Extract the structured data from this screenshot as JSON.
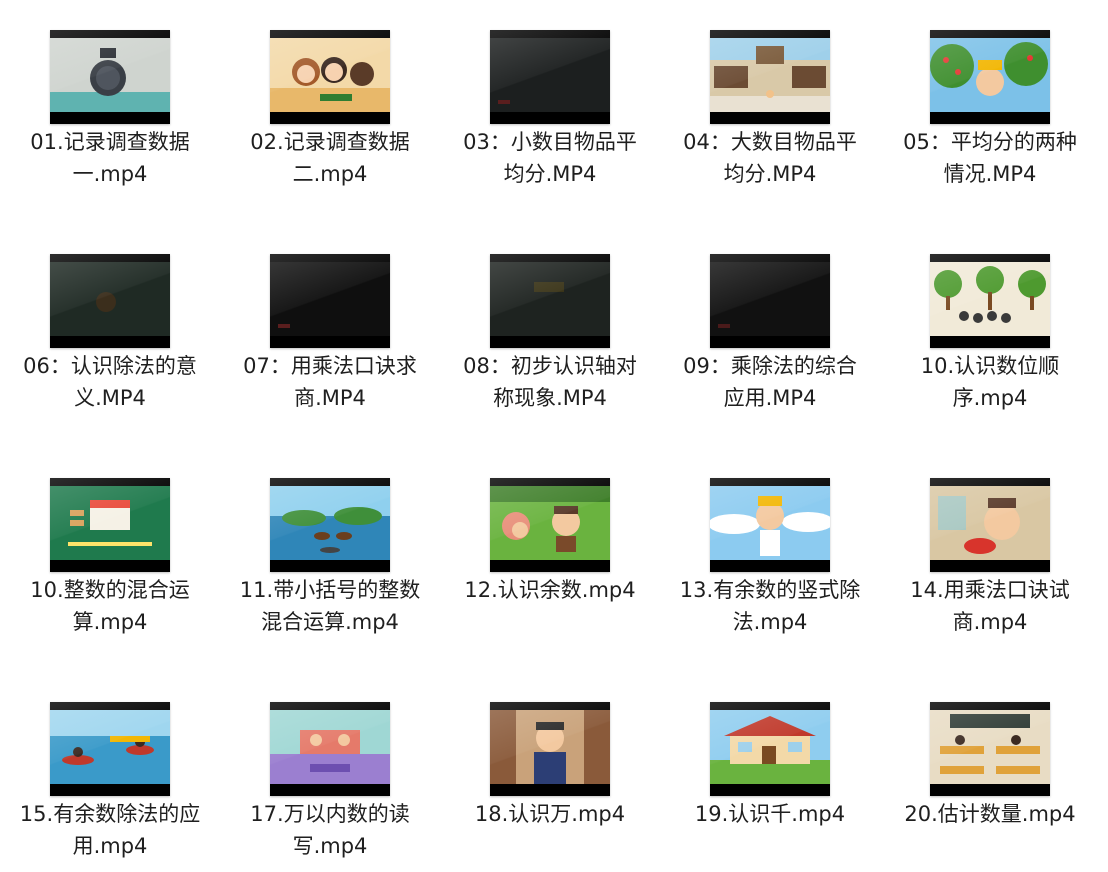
{
  "files": [
    {
      "line1": "01.记录调查数据",
      "line2": "一.mp4",
      "scene": "bell"
    },
    {
      "line1": "02.记录调查数据",
      "line2": "二.mp4",
      "scene": "kids"
    },
    {
      "line1": "03：小数目物品平",
      "line2": "均分.MP4",
      "scene": "dark"
    },
    {
      "line1": "04：大数目物品平",
      "line2": "均分.MP4",
      "scene": "town"
    },
    {
      "line1": "05：平均分的两种",
      "line2": "情况.MP4",
      "scene": "orchard"
    },
    {
      "line1": "06：认识除法的意",
      "line2": "义.MP4",
      "scene": "dark"
    },
    {
      "line1": "07：用乘法口诀求",
      "line2": "商.MP4",
      "scene": "dark"
    },
    {
      "line1": "08：初步认识轴对",
      "line2": "称现象.MP4",
      "scene": "dark"
    },
    {
      "line1": "09：乘除法的综合",
      "line2": "应用.MP4",
      "scene": "dark"
    },
    {
      "line1": "10.认识数位顺",
      "line2": "序.mp4",
      "scene": "trees"
    },
    {
      "line1": "10.整数的混合运",
      "line2": "算.mp4",
      "scene": "greenstore"
    },
    {
      "line1": "11.带小括号的整数",
      "line2": "混合运算.mp4",
      "scene": "lake"
    },
    {
      "line1": "12.认识余数.mp4",
      "line2": "",
      "scene": "meadow"
    },
    {
      "line1": "13.有余数的竖式除",
      "line2": "法.mp4",
      "scene": "sky"
    },
    {
      "line1": "14.用乘法口诀试",
      "line2": "商.mp4",
      "scene": "indoor"
    },
    {
      "line1": "15.有余数除法的应",
      "line2": "用.mp4",
      "scene": "boats"
    },
    {
      "line1": "17.万以内数的读",
      "line2": "写.mp4",
      "scene": "room"
    },
    {
      "line1": "18.认识万.mp4",
      "line2": "",
      "scene": "teacher"
    },
    {
      "line1": "19.认识千.mp4",
      "line2": "",
      "scene": "house"
    },
    {
      "line1": "20.估计数量.mp4",
      "line2": "",
      "scene": "classroom"
    }
  ]
}
